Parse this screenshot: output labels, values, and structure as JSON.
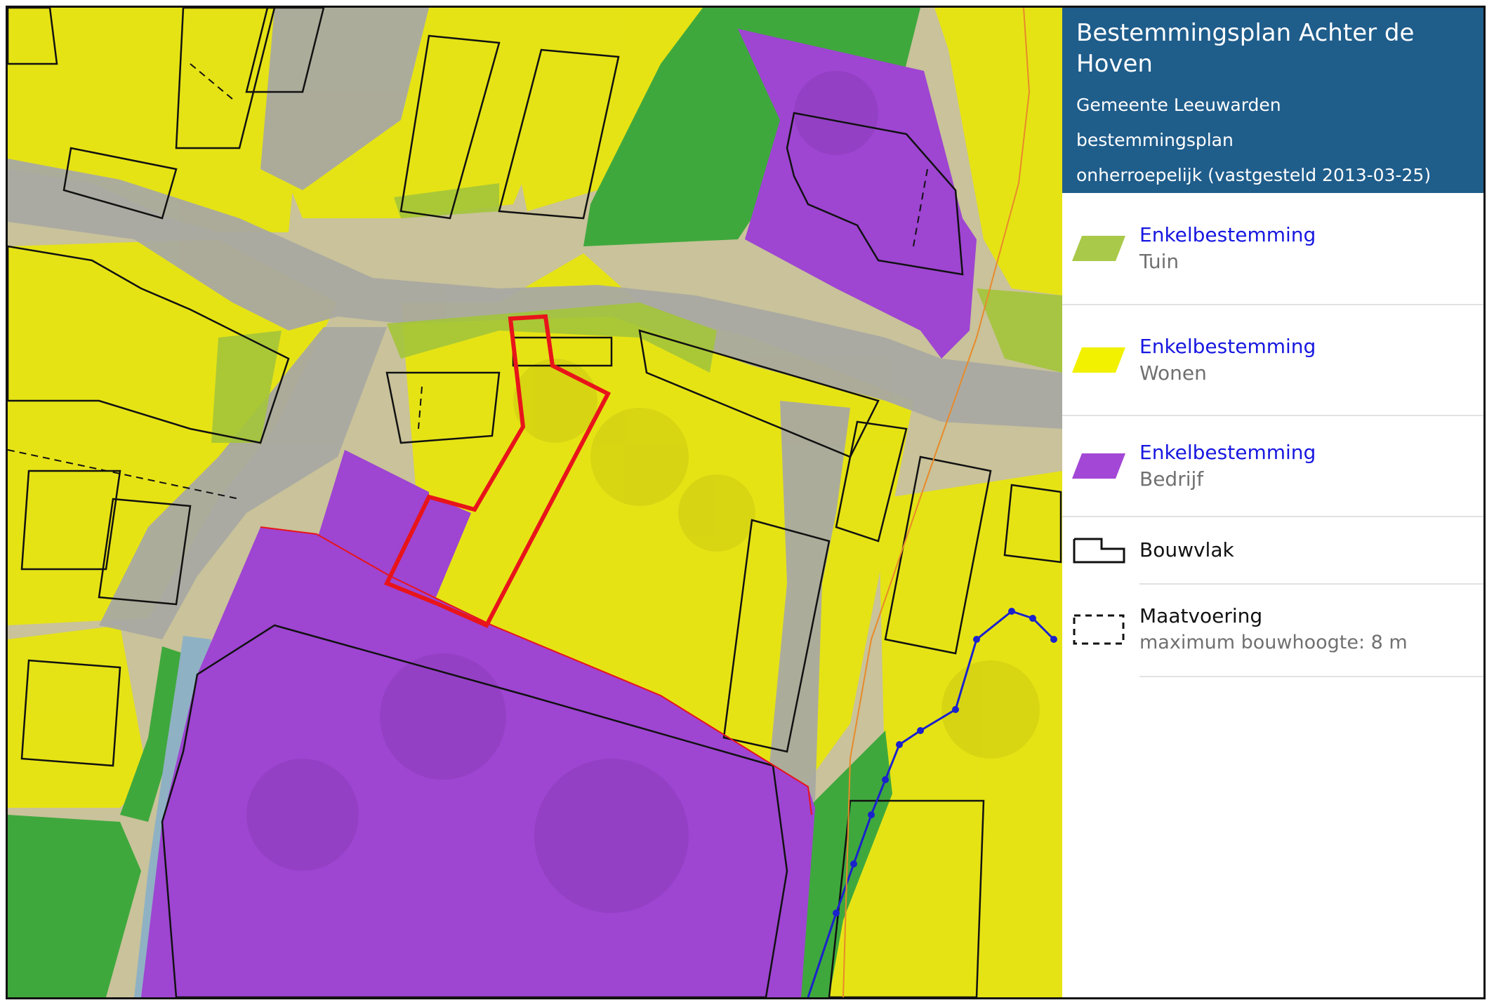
{
  "panel": {
    "title": "Bestemmingsplan Achter de Hoven",
    "municipality": "Gemeente Leeuwarden",
    "plan_type": "bestemmingsplan",
    "status": "onherroepelijk (vastgesteld 2013-03-25)"
  },
  "legend": {
    "tuin": {
      "type": "Enkelbestemming",
      "name": "Tuin",
      "color": "#a9c94a",
      "icon": "swatch-tuin"
    },
    "wonen": {
      "type": "Enkelbestemming",
      "name": "Wonen",
      "color": "#f1f100",
      "icon": "swatch-wonen"
    },
    "bedrijf": {
      "type": "Enkelbestemming",
      "name": "Bedrijf",
      "color": "#a347d6",
      "icon": "swatch-bedrijf"
    },
    "bouwvlak": {
      "label": "Bouwvlak",
      "icon": "bouwvlak-icon"
    },
    "maatvoering": {
      "label": "Maatvoering",
      "detail": "maximum bouwhoogte: 8 m",
      "icon": "maatvoering-icon"
    }
  },
  "map": {
    "colors": {
      "wonen": "#e6e600",
      "tuin": "#7fbf3a",
      "bedrijf": "#9b3fcf",
      "road": "#a8a8a2",
      "groen": "#3aa43a",
      "water": "#8fb1c4",
      "selection": "#e8141a",
      "bouwvlak": "#111111",
      "boundary": "#1a22cc"
    }
  }
}
